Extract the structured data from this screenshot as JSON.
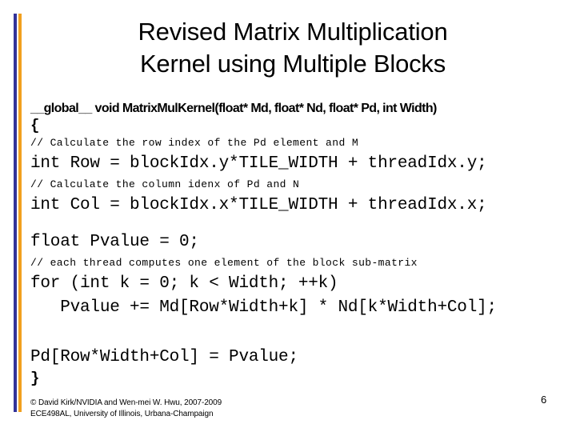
{
  "slide": {
    "page_number": "6",
    "accent_bar_blue_color": "#333399",
    "accent_bar_orange_color": "#F2A01E",
    "background_color": "#FFFFFF",
    "text_color": "#000000"
  },
  "title": {
    "line1": "Revised Matrix Multiplication",
    "line2": "Kernel using Multiple Blocks"
  },
  "code": {
    "lines": [
      {
        "text": "__global__ void MatrixMulKernel(float* Md, float* Nd, float* Pd, int Width)",
        "style": "signature"
      },
      {
        "text": "{",
        "style": "brace"
      },
      {
        "text": "// Calculate the row index of the Pd element and M",
        "style": "comment"
      },
      {
        "text": "int Row = blockIdx.y*TILE_WIDTH + threadIdx.y;",
        "style": "statement"
      },
      {
        "text": "// Calculate the column idenx of Pd and N",
        "style": "comment"
      },
      {
        "text": "int Col = blockIdx.x*TILE_WIDTH + threadIdx.x;",
        "style": "statement"
      },
      {
        "text": "",
        "style": "blank"
      },
      {
        "text": "float Pvalue = 0;",
        "style": "statement"
      },
      {
        "text": "// each thread computes one element of the block sub-matrix",
        "style": "comment"
      },
      {
        "text": "for (int k = 0; k < Width; ++k)",
        "style": "statement"
      },
      {
        "text": "   Pvalue += Md[Row*Width+k] * Nd[k*Width+Col];",
        "style": "statement"
      },
      {
        "text": "",
        "style": "blank"
      },
      {
        "text": "",
        "style": "blank"
      },
      {
        "text": "Pd[Row*Width+Col] = Pvalue;",
        "style": "statement"
      },
      {
        "text": "}",
        "style": "brace"
      }
    ]
  },
  "footer": {
    "line1": "© David Kirk/NVIDIA and Wen-mei W. Hwu, 2007-2009",
    "line2": "ECE498AL, University of Illinois, Urbana-Champaign"
  }
}
